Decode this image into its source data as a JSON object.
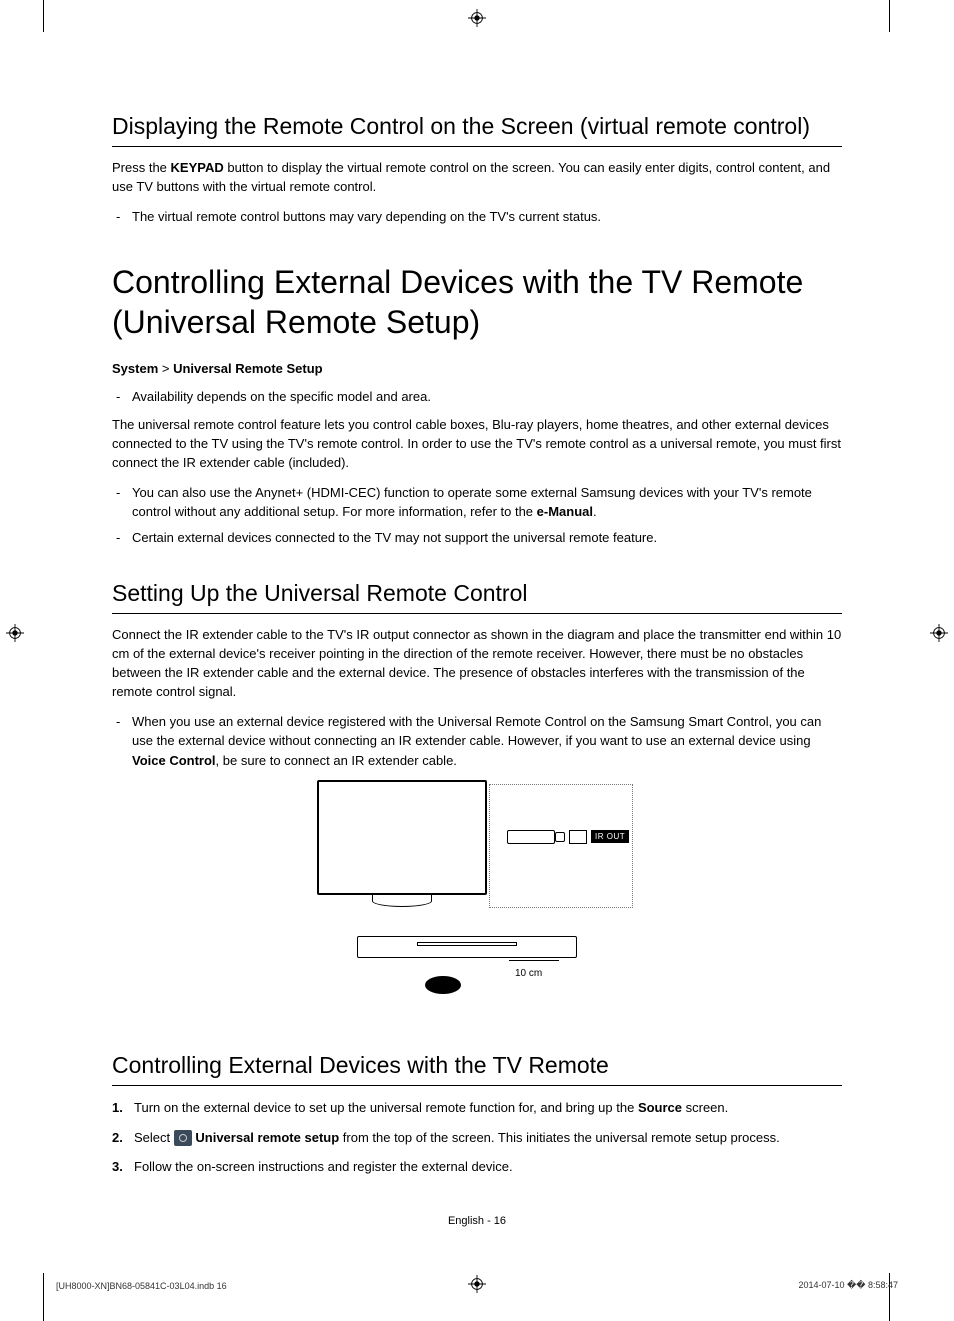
{
  "section1": {
    "heading": "Displaying the Remote Control on the Screen (virtual remote control)",
    "para_pre": "Press the ",
    "keypad": "KEYPAD",
    "para_post": " button to display the virtual remote control on the screen. You can easily enter digits, control content, and use TV buttons with the virtual remote control.",
    "note1": "The virtual remote control buttons may vary depending on the TV's current status."
  },
  "section2": {
    "heading": "Controlling External Devices with the TV Remote (Universal Remote Setup)",
    "breadcrumb_a": "System",
    "breadcrumb_sep": " > ",
    "breadcrumb_b": "Universal Remote Setup",
    "note_avail": "Availability depends on the specific model and area.",
    "para1": "The universal remote control feature lets you control cable boxes, Blu-ray players, home theatres, and other external devices connected to the TV using the TV's remote control. In order to use the TV's remote control as a universal remote, you must first connect the IR extender cable (included).",
    "note_anynet_pre": "You can also use the Anynet+ (HDMI-CEC) function to operate some external Samsung devices with your TV's remote control without any additional setup. For more information, refer to the ",
    "emanual": "e-Manual",
    "note_anynet_post": ".",
    "note_support": "Certain external devices connected to the TV may not support the universal remote feature."
  },
  "section3": {
    "heading": "Setting Up the Universal Remote Control",
    "para1": "Connect the IR extender cable to the TV's IR output connector as shown in the diagram and place the transmitter end within 10 cm of the external device's receiver pointing in the direction of the remote receiver. However, there must be no obstacles between the IR extender cable and the external device. The presence of obstacles interferes with the transmission of the remote control signal.",
    "note_pre": "When you use an external device registered with the Universal Remote Control on the Samsung Smart Control, you can use the external device without connecting an IR extender cable. However, if you want to use an external device using ",
    "voice": "Voice Control",
    "note_post": ", be sure to connect an IR extender cable."
  },
  "diagram": {
    "ir_out": "IR OUT",
    "distance": "10 cm"
  },
  "section4": {
    "heading": "Controlling External Devices with the TV Remote",
    "step1_pre": "Turn on the external device to set up the universal remote function for, and bring up the ",
    "source": "Source",
    "step1_post": " screen.",
    "step2_pre": "Select ",
    "urs": "Universal remote setup",
    "step2_post": " from the top of the screen. This initiates the universal remote setup process.",
    "step3": "Follow the on-screen instructions and register the external device."
  },
  "footer": {
    "center": "English - 16",
    "left": "[UH8000-XN]BN68-05841C-03L04.indb   16",
    "right": "2014-07-10   �� 8:58:47"
  }
}
